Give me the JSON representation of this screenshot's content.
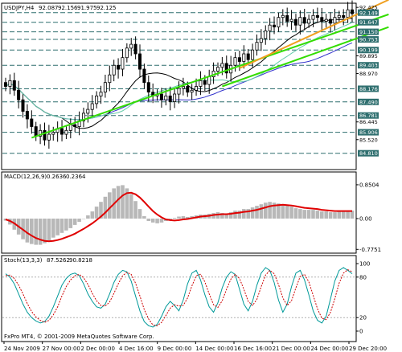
{
  "chart_data": [
    {
      "type": "candlestick",
      "title": "USDJPY,H4",
      "ohlc_header": [
        "92.087",
        "92.156",
        "91.975",
        "92.125"
      ],
      "ylim": [
        84.0,
        92.6
      ],
      "y_ticks": [
        "92.425",
        "92.149",
        "91.647",
        "91.150",
        "90.753",
        "90.199",
        "89.895",
        "89.403",
        "88.970",
        "88.176",
        "87.490",
        "86.781",
        "86.445",
        "85.906",
        "85.520",
        "84.810"
      ],
      "dark_levels": [
        92.149,
        91.647,
        91.15,
        90.753,
        90.199,
        89.403,
        88.176,
        87.49,
        86.781,
        85.906,
        84.81
      ],
      "plain_levels": [
        92.425,
        89.895,
        88.97,
        86.445,
        85.52
      ],
      "closes": [
        88.3,
        88.6,
        88.1,
        87.6,
        87.0,
        86.6,
        86.2,
        85.7,
        86.0,
        85.5,
        85.8,
        85.9,
        86.1,
        85.8,
        86.0,
        86.3,
        86.2,
        86.5,
        86.9,
        87.1,
        87.4,
        87.8,
        88.0,
        88.5,
        88.9,
        89.4,
        89.2,
        89.8,
        90.3,
        90.5,
        90.0,
        89.2,
        88.5,
        88.0,
        87.8,
        87.9,
        87.6,
        87.8,
        87.5,
        87.9,
        88.2,
        88.3,
        88.0,
        88.1,
        88.3,
        88.6,
        88.4,
        88.8,
        89.1,
        89.3,
        89.5,
        89.0,
        89.4,
        89.8,
        89.6,
        90.0,
        89.7,
        90.2,
        90.6,
        90.8,
        91.2,
        91.5,
        91.4,
        91.9,
        92.0,
        91.7,
        91.8,
        91.5,
        91.9,
        91.6,
        91.8,
        92.0,
        91.9,
        91.7,
        91.8,
        91.6,
        91.9,
        92.0,
        91.9,
        92.3,
        92.1
      ],
      "trendlines": [
        {
          "color": "#33dd00",
          "from": [
            6,
            85.62
          ],
          "to": [
            81,
            91.48
          ]
        },
        {
          "color": "#33dd00",
          "from": [
            50,
            88.3
          ],
          "to": [
            81,
            90.8
          ]
        },
        {
          "color": "#f0a020",
          "from": [
            54,
            89.25
          ],
          "to": [
            81,
            92.05
          ]
        }
      ],
      "ma_colors": [
        "#3333cc",
        "#000000",
        "#66ccaa"
      ]
    },
    {
      "type": "histogram",
      "title": "MACD(12,26,9)",
      "values_header": [
        "0.2636",
        "0.2364"
      ],
      "ylim": [
        -0.85,
        0.95
      ],
      "y_ticks": [
        "0.8504",
        "0.00",
        "-0.7751"
      ],
      "histogram": [
        -0.05,
        -0.15,
        -0.28,
        -0.4,
        -0.52,
        -0.6,
        -0.64,
        -0.66,
        -0.66,
        -0.62,
        -0.56,
        -0.48,
        -0.42,
        -0.36,
        -0.3,
        -0.24,
        -0.16,
        -0.08,
        0.0,
        0.08,
        0.18,
        0.3,
        0.42,
        0.55,
        0.66,
        0.76,
        0.82,
        0.84,
        0.76,
        0.62,
        0.44,
        0.24,
        0.06,
        -0.06,
        -0.1,
        -0.12,
        -0.1,
        -0.06,
        -0.02,
        0.02,
        0.05,
        0.06,
        0.04,
        0.06,
        0.08,
        0.1,
        0.1,
        0.12,
        0.14,
        0.16,
        0.14,
        0.12,
        0.16,
        0.2,
        0.2,
        0.24,
        0.24,
        0.28,
        0.32,
        0.36,
        0.4,
        0.42,
        0.4,
        0.38,
        0.36,
        0.32,
        0.3,
        0.26,
        0.24,
        0.22,
        0.22,
        0.22,
        0.2,
        0.18,
        0.18,
        0.16,
        0.16,
        0.18,
        0.18,
        0.2,
        0.2
      ],
      "signal": [
        -0.02,
        -0.06,
        -0.12,
        -0.2,
        -0.28,
        -0.36,
        -0.43,
        -0.49,
        -0.53,
        -0.56,
        -0.57,
        -0.56,
        -0.54,
        -0.51,
        -0.47,
        -0.43,
        -0.38,
        -0.32,
        -0.26,
        -0.19,
        -0.12,
        -0.04,
        0.05,
        0.15,
        0.26,
        0.37,
        0.48,
        0.58,
        0.64,
        0.65,
        0.61,
        0.53,
        0.42,
        0.3,
        0.19,
        0.1,
        0.03,
        -0.02,
        -0.04,
        -0.05,
        -0.04,
        -0.02,
        -0.01,
        0.01,
        0.03,
        0.05,
        0.06,
        0.07,
        0.09,
        0.1,
        0.11,
        0.11,
        0.12,
        0.14,
        0.15,
        0.17,
        0.18,
        0.2,
        0.22,
        0.25,
        0.28,
        0.31,
        0.33,
        0.34,
        0.35,
        0.34,
        0.33,
        0.31,
        0.29,
        0.27,
        0.26,
        0.25,
        0.24,
        0.22,
        0.21,
        0.2,
        0.19,
        0.19,
        0.19,
        0.19,
        0.19
      ]
    },
    {
      "type": "line",
      "title": "Stoch(13,3,3)",
      "values_header": [
        "87.5262",
        "90.8218"
      ],
      "ylim": [
        0,
        100
      ],
      "y_ticks": [
        "100",
        "80",
        "20",
        "0"
      ],
      "main": [
        85,
        80,
        70,
        55,
        40,
        28,
        20,
        15,
        12,
        14,
        22,
        36,
        52,
        68,
        78,
        84,
        86,
        82,
        70,
        55,
        44,
        36,
        34,
        40,
        55,
        72,
        84,
        90,
        88,
        74,
        52,
        30,
        14,
        8,
        6,
        10,
        22,
        36,
        44,
        38,
        30,
        46,
        70,
        86,
        90,
        76,
        54,
        36,
        28,
        42,
        64,
        80,
        88,
        84,
        62,
        40,
        30,
        44,
        68,
        86,
        94,
        90,
        72,
        46,
        28,
        40,
        66,
        86,
        90,
        76,
        54,
        30,
        16,
        12,
        22,
        48,
        74,
        90,
        94,
        90,
        85
      ],
      "signal": [
        82,
        83,
        78,
        68,
        55,
        41,
        29,
        21,
        16,
        13,
        16,
        24,
        36,
        52,
        66,
        76,
        82,
        84,
        79,
        69,
        56,
        45,
        38,
        37,
        43,
        56,
        70,
        82,
        87,
        84,
        71,
        52,
        32,
        18,
        9,
        8,
        13,
        23,
        34,
        39,
        37,
        38,
        49,
        67,
        82,
        84,
        73,
        55,
        39,
        35,
        45,
        62,
        77,
        84,
        78,
        62,
        44,
        38,
        47,
        66,
        83,
        90,
        85,
        69,
        49,
        38,
        45,
        64,
        81,
        84,
        73,
        53,
        33,
        19,
        17,
        28,
        48,
        71,
        86,
        91,
        88
      ],
      "levels": [
        80,
        20
      ],
      "main_color": "#009999",
      "signal_color": "#cc0000"
    }
  ],
  "x_ticks": [
    "24 Nov 2009",
    "27 Nov 00:00",
    "2 Dec 00:00",
    "4 Dec 16:00",
    "9 Dec 00:00",
    "14 Dec 00:00",
    "16 Dec 16:00",
    "21 Dec 00:00",
    "24 Dec 00:00",
    "29 Dec 20:00"
  ],
  "footer": {
    "line1": "FxPro MT4, © 2001-2009 MetaQuotes Software Corp."
  }
}
